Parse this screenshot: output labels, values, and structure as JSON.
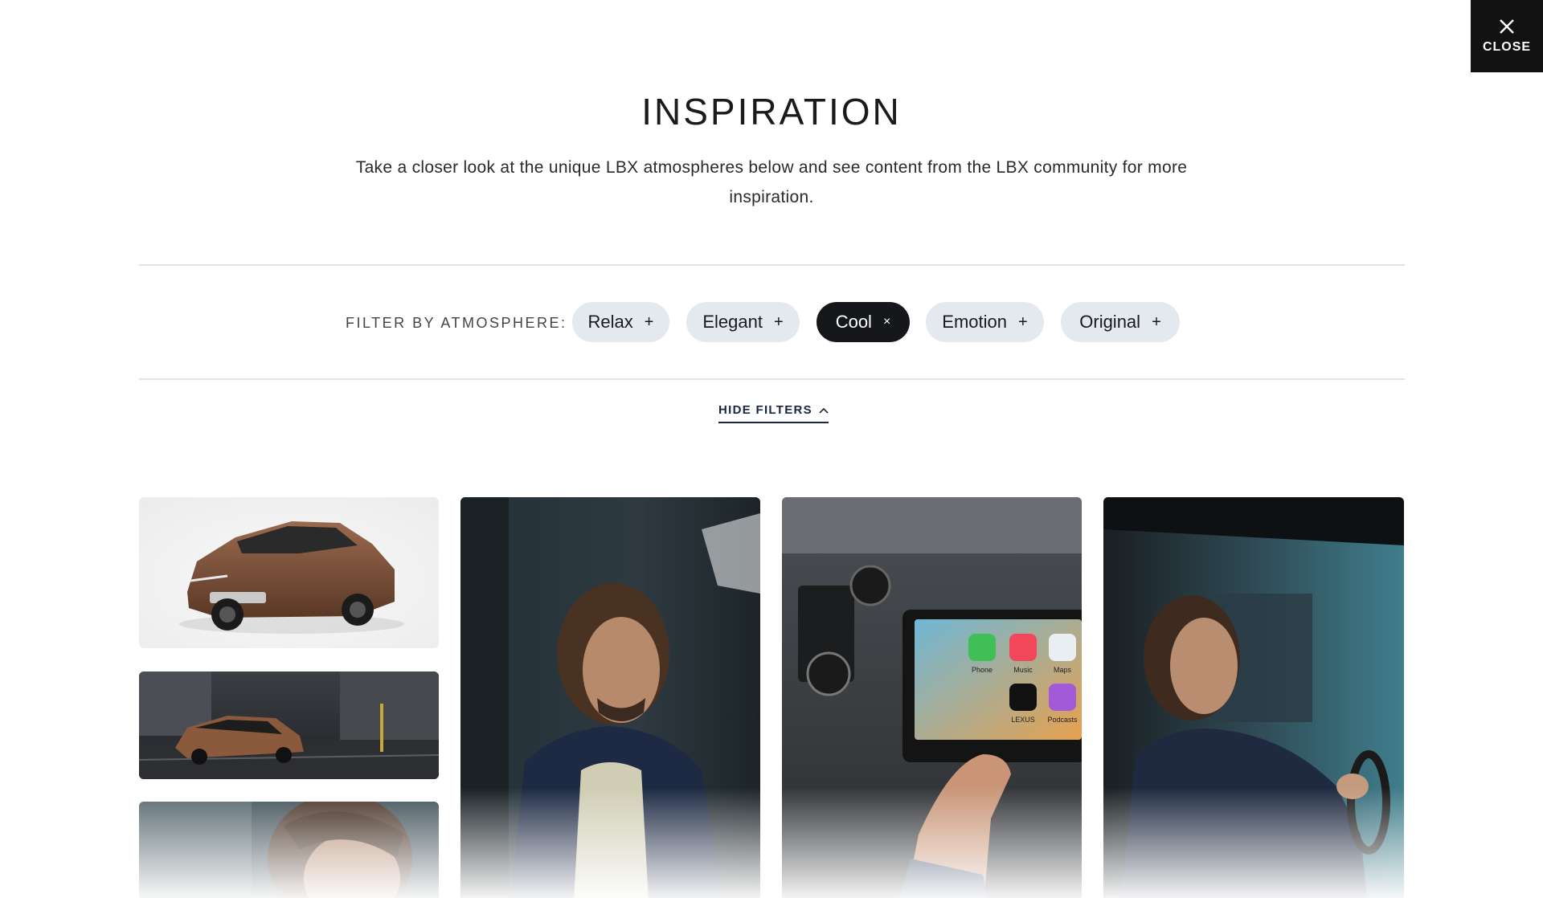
{
  "close": {
    "label": "CLOSE"
  },
  "header": {
    "title": "INSPIRATION",
    "subtitle": "Take a closer look at the unique LBX atmospheres below and see content from the LBX community for more inspiration."
  },
  "filters": {
    "label": "FILTER BY ATMOSPHERE:",
    "chips": [
      {
        "label": "Relax",
        "active": false,
        "symbol": "+"
      },
      {
        "label": "Elegant",
        "active": false,
        "symbol": "+"
      },
      {
        "label": "Cool",
        "active": true,
        "symbol": "×"
      },
      {
        "label": "Emotion",
        "active": false,
        "symbol": "+"
      },
      {
        "label": "Original",
        "active": false,
        "symbol": "+"
      }
    ],
    "toggle_label": "HIDE FILTERS"
  },
  "gallery": {
    "car_screen_apps": [
      "Phone",
      "Music",
      "Maps",
      "LEXUS",
      "Podcasts"
    ]
  },
  "colors": {
    "chip_bg": "#e4e9f0",
    "chip_active_bg": "#15171a",
    "close_bg": "#121212",
    "link_color": "#1b2540"
  }
}
